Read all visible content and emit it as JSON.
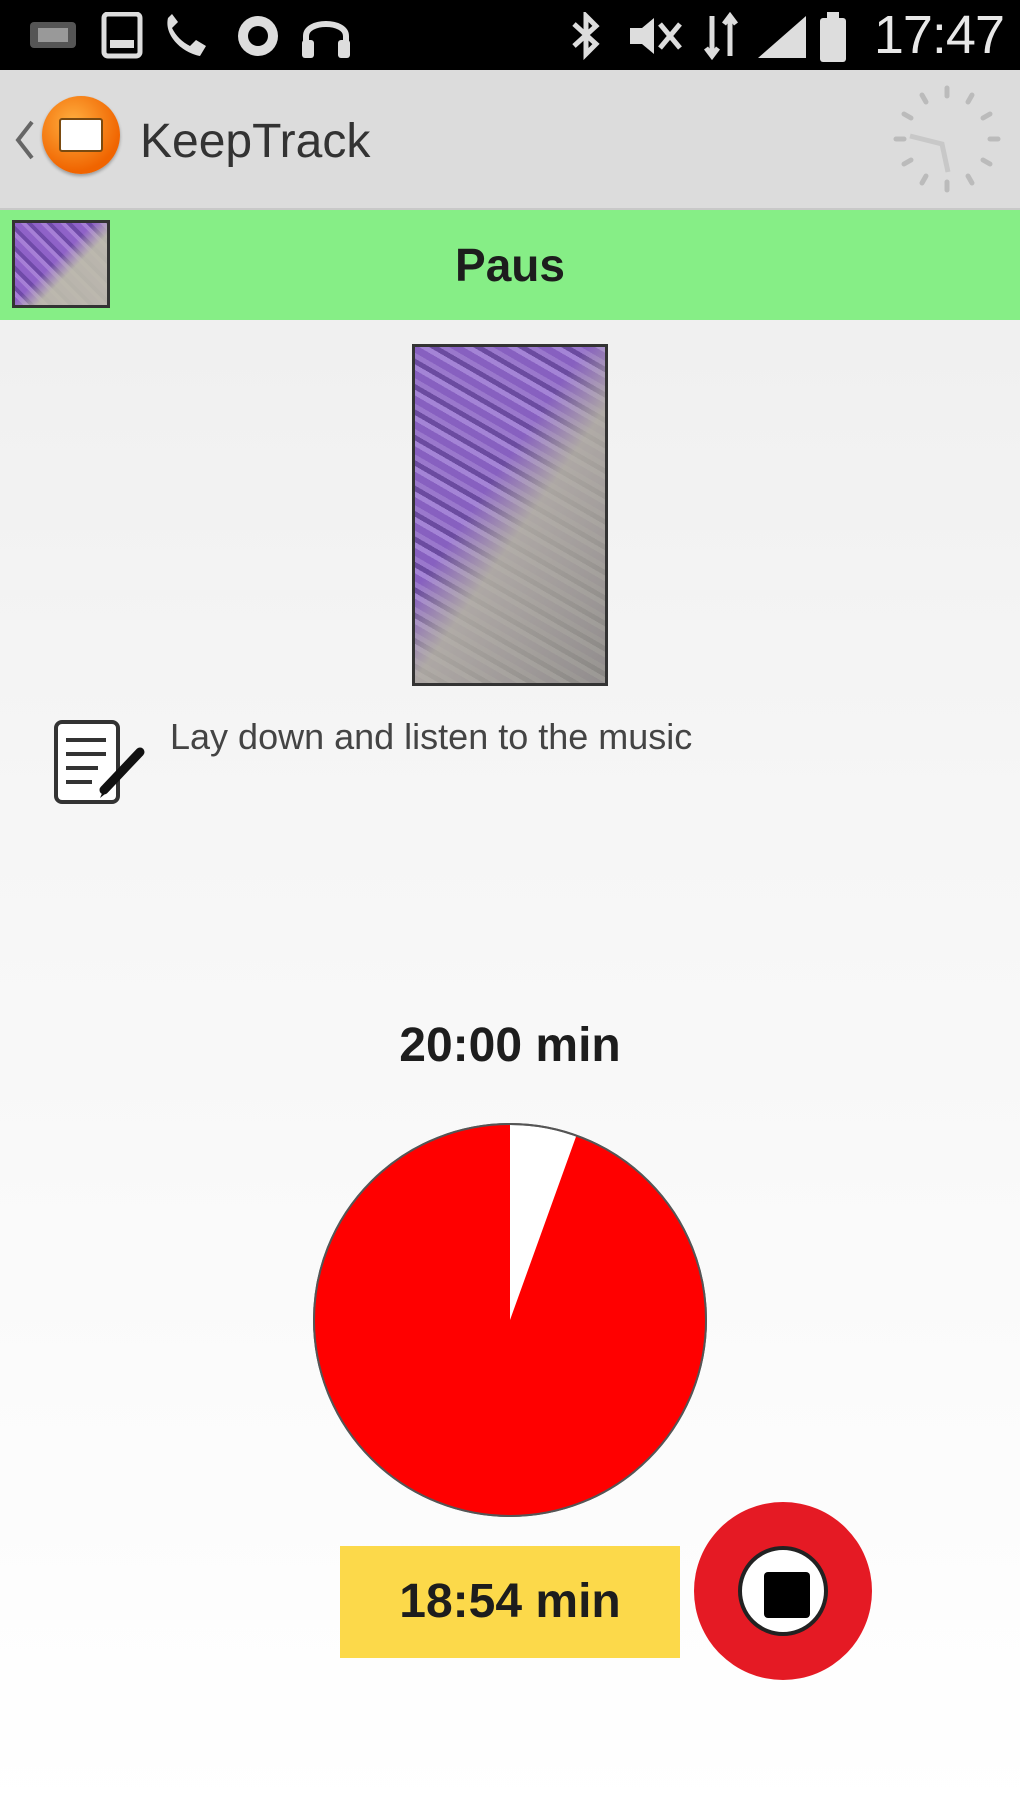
{
  "status_bar": {
    "time": "17:47",
    "icons": [
      "media-icon",
      "tablet-icon",
      "phone-icon",
      "app-icon",
      "headphones-icon",
      "bluetooth-icon",
      "mute-icon",
      "data-icon",
      "signal-icon",
      "battery-icon"
    ]
  },
  "action_bar": {
    "app_title": "KeepTrack",
    "back_icon": "chevron-left-icon",
    "right_icon": "timer-icon"
  },
  "activity": {
    "title": "Paus",
    "note": "Lay  down  and listen to the music",
    "duration": "20:00 min",
    "remaining": "18:54 min",
    "elapsed_fraction": 0.945,
    "colors": {
      "titlebar": "#86ee86",
      "pie": "#ff0000",
      "remaining_bg": "#fcd94a",
      "stop": "#e51a24"
    }
  }
}
